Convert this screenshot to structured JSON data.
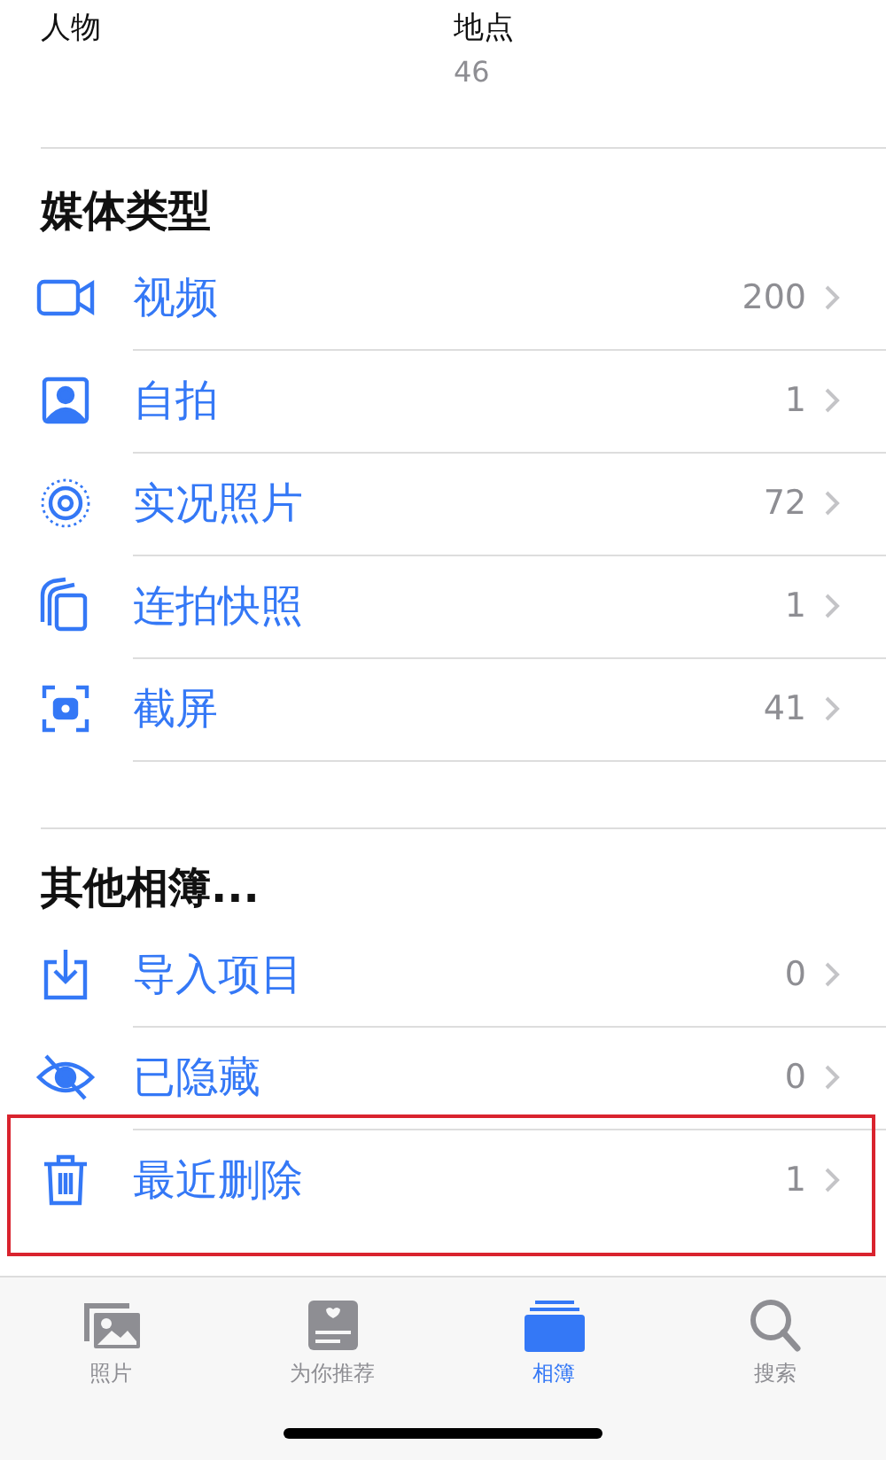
{
  "top_albums": [
    {
      "title": "人物"
    },
    {
      "title": "地点",
      "count": "46"
    }
  ],
  "sections": [
    {
      "title": "媒体类型",
      "items": [
        {
          "kind": "video",
          "label": "视频",
          "count": "200",
          "highlighted": false
        },
        {
          "kind": "selfie",
          "label": "自拍",
          "count": "1",
          "highlighted": false
        },
        {
          "kind": "live",
          "label": "实况照片",
          "count": "72",
          "highlighted": false
        },
        {
          "kind": "burst",
          "label": "连拍快照",
          "count": "1",
          "highlighted": false
        },
        {
          "kind": "screenshot",
          "label": "截屏",
          "count": "41",
          "highlighted": false
        }
      ]
    },
    {
      "title": "其他相簿...",
      "items": [
        {
          "kind": "import",
          "label": "导入项目",
          "count": "0",
          "highlighted": false
        },
        {
          "kind": "hidden",
          "label": "已隐藏",
          "count": "0",
          "highlighted": false
        },
        {
          "kind": "trash",
          "label": "最近删除",
          "count": "1",
          "highlighted": true
        }
      ]
    }
  ],
  "tab_bar": [
    {
      "kind": "photos",
      "label": "照片",
      "selected": false
    },
    {
      "kind": "foryou",
      "label": "为你推荐",
      "selected": false
    },
    {
      "kind": "albums",
      "label": "相簿",
      "selected": true
    },
    {
      "kind": "search",
      "label": "搜索",
      "selected": false
    }
  ]
}
